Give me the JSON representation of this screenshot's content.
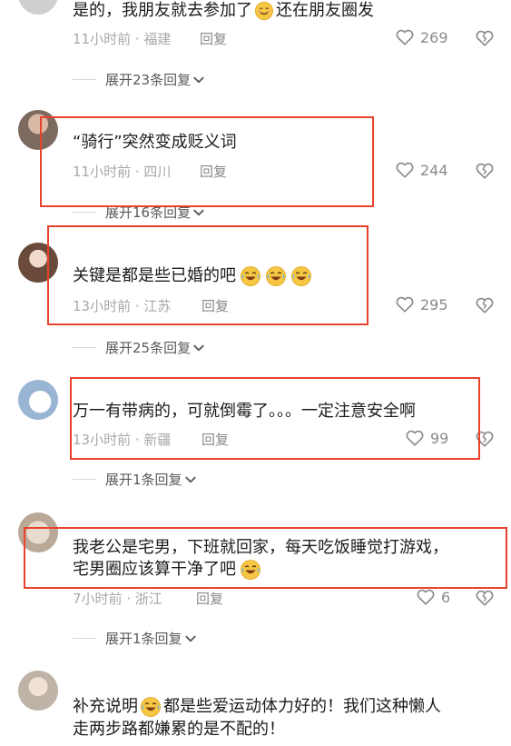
{
  "comments": [
    {
      "username": "",
      "text": "是的，我朋友就去参加了",
      "text_after": "还在朋友圈发",
      "time": "11小时前",
      "location": "福建",
      "reply_label": "回复",
      "likes": "269",
      "expand_label": "展开23条回复"
    },
    {
      "username": "",
      "text": "“骑行”突然变成贬义词",
      "time": "11小时前",
      "location": "四川",
      "reply_label": "回复",
      "likes": "244",
      "expand_label": "展开16条回复"
    },
    {
      "username": "",
      "text": "关键是都是些已婚的吧",
      "time": "13小时前",
      "location": "江苏",
      "reply_label": "回复",
      "likes": "295",
      "expand_label": "展开25条回复"
    },
    {
      "username": "",
      "text": "万一有带病的，可就倒霉了。。。一定注意安全啊",
      "time": "13小时前",
      "location": "新疆",
      "reply_label": "回复",
      "likes": "99",
      "expand_label": "展开1条回复"
    },
    {
      "username": "",
      "text_line1": "我老公是宅男，下班就回家，每天吃饭睡觉打游戏，",
      "text_line2": "宅男圈应该算干净了吧",
      "time": "7小时前",
      "location": "浙江",
      "reply_label": "回复",
      "likes": "6",
      "expand_label": "展开1条回复"
    },
    {
      "username": "",
      "text_line1_a": "补充说明",
      "text_line1_b": "都是些爱运动体力好的！我们这种懒人",
      "text_line2": "走两步路都嫌累的是不配的！"
    }
  ],
  "separator": " · ",
  "colors": {
    "highlight_box": "#e8412c",
    "meta": "#a8a8a8",
    "text": "#1c1c1c"
  },
  "icons": [
    "heart-outline-icon",
    "broken-heart-icon",
    "chevron-down-icon",
    "laughing-tears-emoji",
    "smile-emoji"
  ]
}
